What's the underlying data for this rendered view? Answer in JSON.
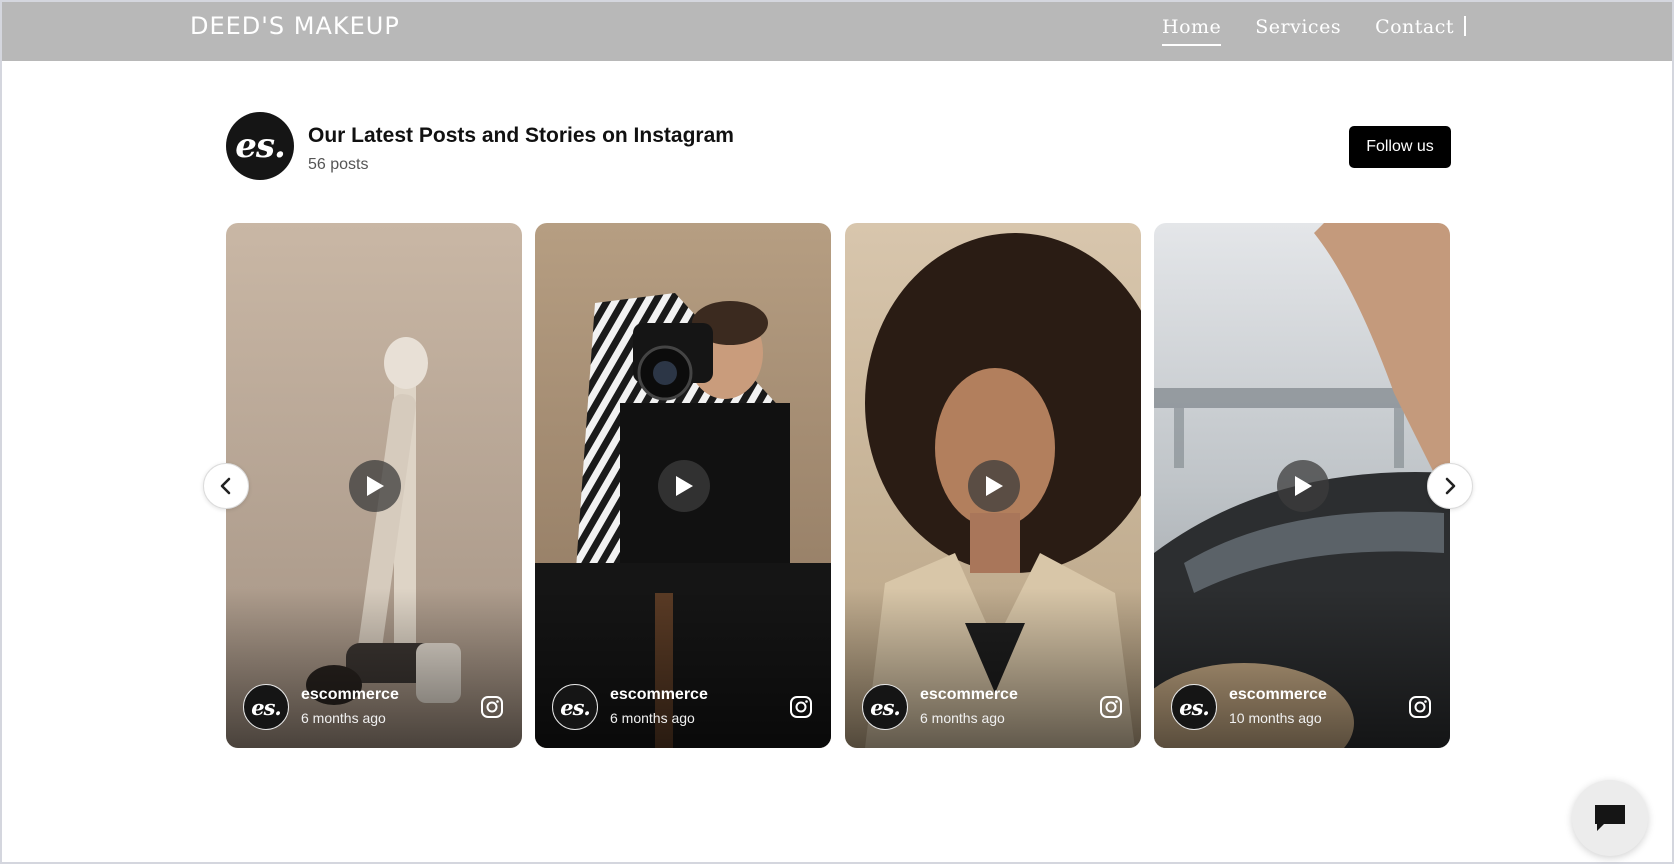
{
  "header": {
    "brand": "DEED'S MAKEUP",
    "nav": [
      {
        "label": "Home",
        "active": true
      },
      {
        "label": "Services",
        "active": false
      },
      {
        "label": "Contact",
        "active": false
      }
    ]
  },
  "feed": {
    "logo_text": "es.",
    "title": "Our Latest Posts and Stories on Instagram",
    "post_count": "56 posts",
    "follow_label": "Follow us",
    "posts": [
      {
        "user": "escommerce",
        "time": "6 months ago",
        "avatar_text": "es.",
        "icon": "instagram-icon"
      },
      {
        "user": "escommerce",
        "time": "6 months ago",
        "avatar_text": "es.",
        "icon": "instagram-icon"
      },
      {
        "user": "escommerce",
        "time": "6 months ago",
        "avatar_text": "es.",
        "icon": "instagram-icon"
      },
      {
        "user": "escommerce",
        "time": "10 months ago",
        "avatar_text": "es.",
        "icon": "instagram-icon"
      }
    ]
  },
  "icons": {
    "prev": "chevron-left-icon",
    "next": "chevron-right-icon",
    "play": "play-icon",
    "chat": "chat-bubble-icon"
  },
  "colors": {
    "header_bg": "#b8b8b8",
    "button_bg": "#000000",
    "logo_bg": "#151515"
  }
}
